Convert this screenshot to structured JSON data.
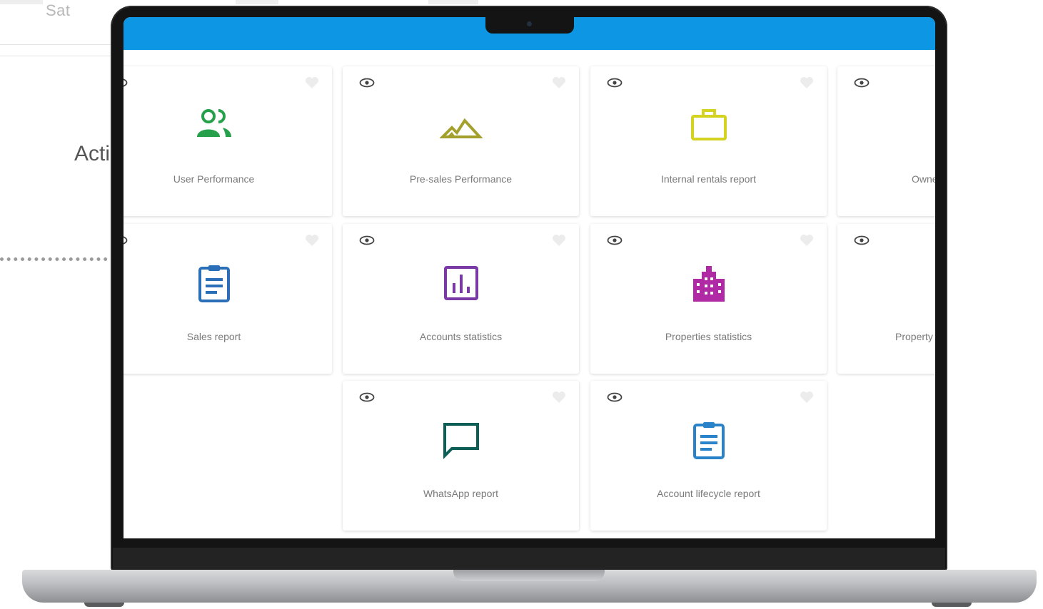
{
  "background": {
    "day_label": "Sat",
    "heading_fragment": "Acti"
  },
  "cards": [
    {
      "label": "User Performance",
      "icon": "users-icon",
      "color": "#26a04a"
    },
    {
      "label": "Pre-sales Performance",
      "icon": "mountain-icon",
      "color": "#a3a12c"
    },
    {
      "label": "Internal rentals report",
      "icon": "briefcase-icon",
      "color": "#d5d321"
    },
    {
      "label": "Owne",
      "icon": "hidden",
      "color": "#7a7a7a"
    },
    {
      "label": "Sales report",
      "icon": "clipboard-icon",
      "color": "#2a6fb8"
    },
    {
      "label": "Accounts statistics",
      "icon": "bar-chart-icon",
      "color": "#7a3aa6"
    },
    {
      "label": "Properties statistics",
      "icon": "building-icon",
      "color": "#b02aa6"
    },
    {
      "label": "Property",
      "icon": "hidden",
      "color": "#7a7a7a"
    },
    {
      "label": "WhatsApp report",
      "icon": "chat-bubble-icon",
      "color": "#0d5e56"
    },
    {
      "label": "Account lifecycle report",
      "icon": "clipboard-icon",
      "color": "#2a83c8"
    }
  ],
  "colors": {
    "topbar": "#0c96e4",
    "eye_icon": "#444444",
    "heart_icon": "#ececec"
  }
}
